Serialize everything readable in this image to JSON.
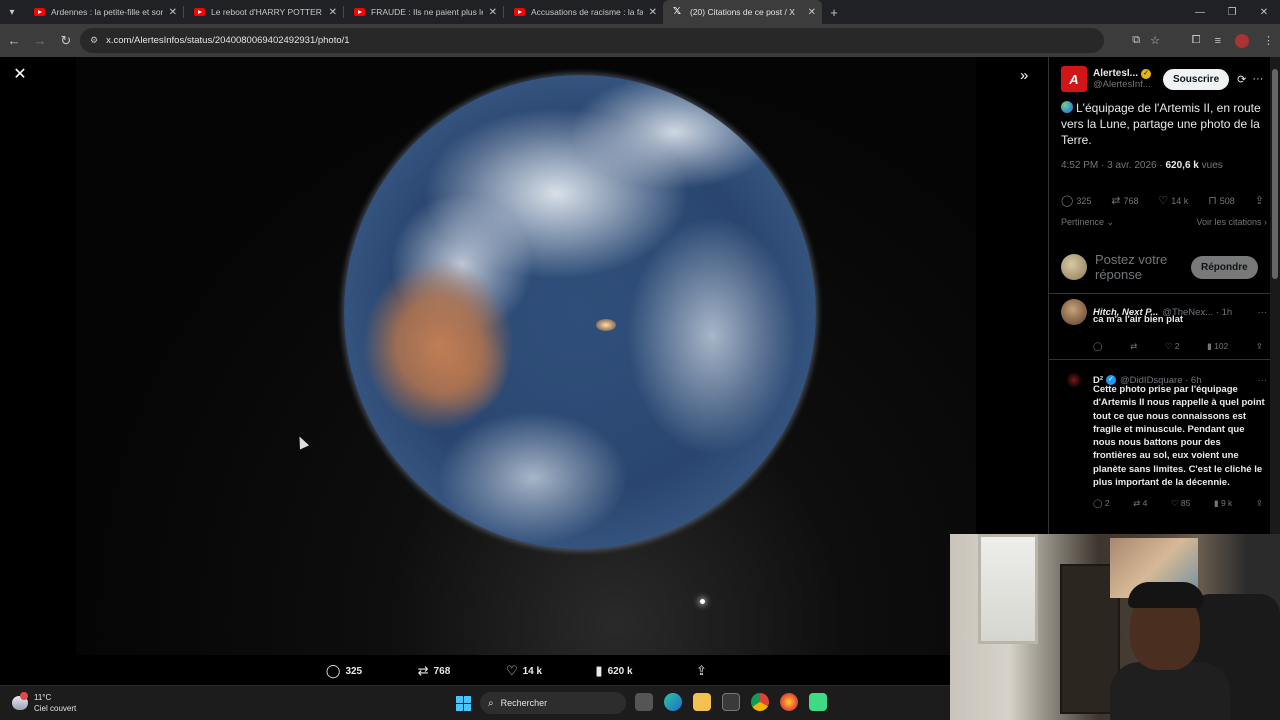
{
  "browser": {
    "tabs": [
      {
        "title": "Ardennes : la petite-fille et son",
        "icon": "youtube-icon",
        "active": false
      },
      {
        "title": "Le reboot d'HARRY POTTER div",
        "icon": "youtube-icon",
        "active": false
      },
      {
        "title": "FRAUDE : Ils ne paient plus leur",
        "icon": "youtube-icon",
        "active": false
      },
      {
        "title": "Accusations de racisme : la fab",
        "icon": "youtube-icon",
        "active": false
      },
      {
        "title": "(20) Citations de ce post / X",
        "icon": "x-icon",
        "active": true
      }
    ],
    "url": "x.com/AlertesInfos/status/2040080069402492931/photo/1"
  },
  "viewer": {
    "actions": {
      "replies": "325",
      "reposts": "768",
      "likes": "14 k",
      "views": "620 k"
    }
  },
  "post": {
    "author_name": "AlertesI...",
    "author_handle": "@AlertesInf...",
    "avatar_letter": "A",
    "follow_label": "Souscrire",
    "text": "L'équipage de l'Artemis II, en route vers la Lune, partage une photo de la Terre.",
    "time": "4:52 PM · 3 avr. 2026 · ",
    "views_count": "620,6 k",
    "views_label": " vues",
    "stats": {
      "replies": "325",
      "reposts": "768",
      "likes": "14 k",
      "bookmarks": "508"
    },
    "sort_label": "Pertinence",
    "quotes_link": "Voir les citations",
    "reply_placeholder": "Postez votre réponse",
    "reply_button": "Répondre"
  },
  "replies": [
    {
      "name": "Hitch, Next P...",
      "handle": "@TheNex... · 1h",
      "text": "ca m'a l'air bien plat",
      "reposts": "",
      "likes": "2",
      "views": "102"
    },
    {
      "name": "D²",
      "handle": "@DidIDsquare · 6h",
      "text": "Cette photo prise par l'équipage d'Artemis II nous rappelle à quel point tout ce que nous connaissons est fragile et minuscule. Pendant que nous nous battons pour des frontières au sol, eux voient une planète sans limites. C'est le cliché le plus important de la décennie.",
      "replies": "2",
      "reposts": "4",
      "likes": "85",
      "views": "9 k"
    }
  ],
  "taskbar": {
    "temperature": "11°C",
    "weather": "Ciel couvert",
    "search_placeholder": "Rechercher"
  }
}
